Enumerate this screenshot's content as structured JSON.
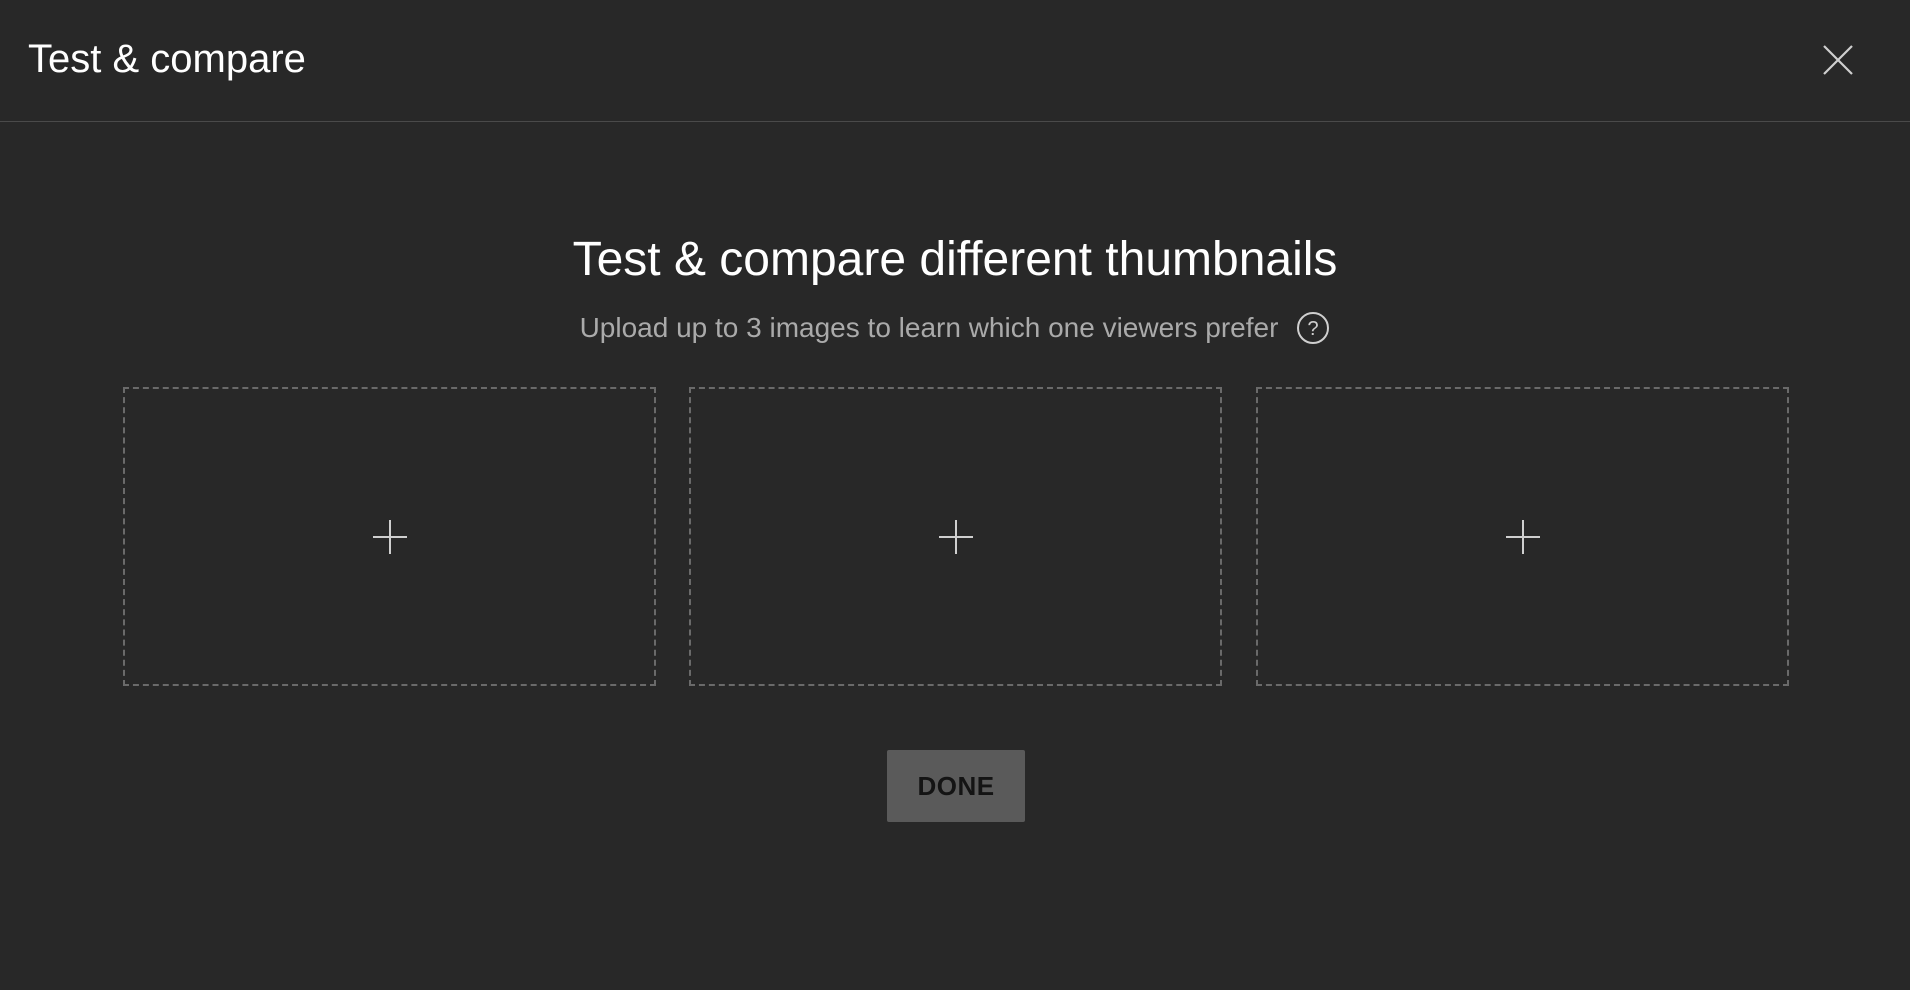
{
  "dialog": {
    "title": "Test & compare",
    "close_icon": "close-icon"
  },
  "content": {
    "heading": "Test & compare different thumbnails",
    "subtitle": "Upload up to 3 images to learn which one viewers prefer",
    "help_icon": "help-circle-icon"
  },
  "slots": [
    {
      "icon": "plus-icon"
    },
    {
      "icon": "plus-icon"
    },
    {
      "icon": "plus-icon"
    }
  ],
  "actions": {
    "done_label": "DONE"
  },
  "colors": {
    "background": "#282828",
    "divider": "#4a4a4a",
    "title_text": "#ffffff",
    "subtitle_text": "#aaaaaa",
    "slot_border": "#6a6a6a",
    "done_button_bg": "#5a5a5a",
    "done_button_text": "#141414"
  }
}
